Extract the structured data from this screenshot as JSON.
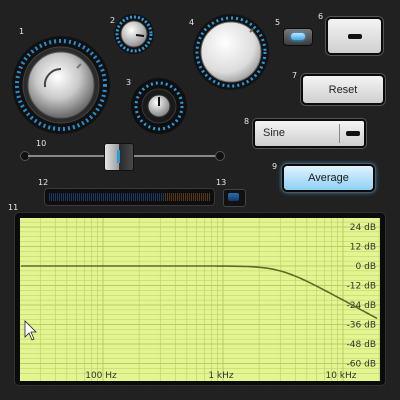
{
  "labels": {
    "n1": "1",
    "n2": "2",
    "n3": "3",
    "n4": "4",
    "n5": "5",
    "n6": "6",
    "n7": "7",
    "n8": "8",
    "n9": "9",
    "n10": "10",
    "n11": "11",
    "n12": "12",
    "n13": "13"
  },
  "reset_button": {
    "label": "Reset"
  },
  "waveform_select": {
    "value": "Sine"
  },
  "average_button": {
    "label": "Average"
  },
  "slider": {
    "value": 0.5
  },
  "plot": {
    "y_ticks": [
      "24 dB",
      "12 dB",
      "0 dB",
      "-12 dB",
      "-24 dB",
      "-36 dB",
      "-48 dB",
      "-60 dB"
    ],
    "x_ticks": [
      "100 Hz",
      "1 kHz",
      "10 kHz"
    ],
    "background": "#e3f590",
    "grid_color": "#b8cc66",
    "curve_color": "#5a6a2a"
  },
  "colors": {
    "accent": "#2a9be3",
    "led": "#3aa8ee"
  }
}
